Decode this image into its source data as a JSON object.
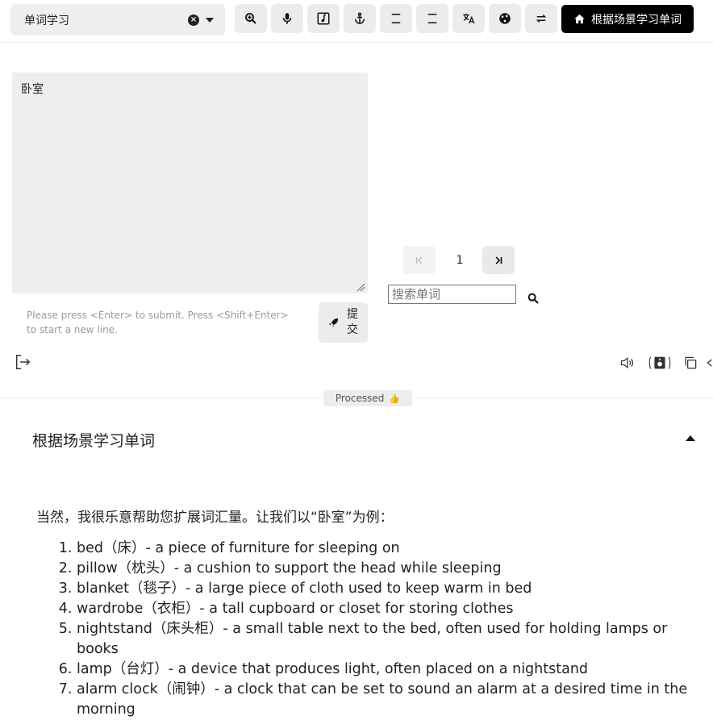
{
  "topbar": {
    "select_label": "单词学习",
    "home_button_label": "根据场景学习单词",
    "tool_icons": [
      "zoom-in-icon",
      "microphone-icon",
      "music-note-icon",
      "anchor-icon",
      "minus-bar-icon",
      "minus-bar-icon",
      "translate-icon",
      "palette-icon",
      "swap-icon"
    ]
  },
  "editor": {
    "text": "卧室",
    "hint": "Please press <Enter> to submit. Press <Shift+Enter> to start a new line.",
    "submit_label": "提交"
  },
  "pagination": {
    "current": "1"
  },
  "search": {
    "placeholder": "搜索单词"
  },
  "status": {
    "badge": "Processed",
    "badge_icon": "👍"
  },
  "result": {
    "title": "根据场景学习单词",
    "intro": "当然，我很乐意帮助您扩展词汇量。让我们以“卧室”为例：",
    "items": [
      "bed（床）- a piece of furniture for sleeping on",
      "pillow（枕头）- a cushion to support the head while sleeping",
      "blanket（毯子）- a large piece of cloth used to keep warm in bed",
      "wardrobe（衣柜）- a tall cupboard or closet for storing clothes",
      "nightstand（床头柜）- a small table next to the bed, often used for holding lamps or books",
      "lamp（台灯）- a device that produces light, often placed on a nightstand",
      "alarm clock（闹钟）- a clock that can be set to sound an alarm at a desired time in the morning"
    ]
  },
  "colors": {
    "accent": "#000000",
    "panel": "#eeeeee",
    "button": "#ececec"
  }
}
